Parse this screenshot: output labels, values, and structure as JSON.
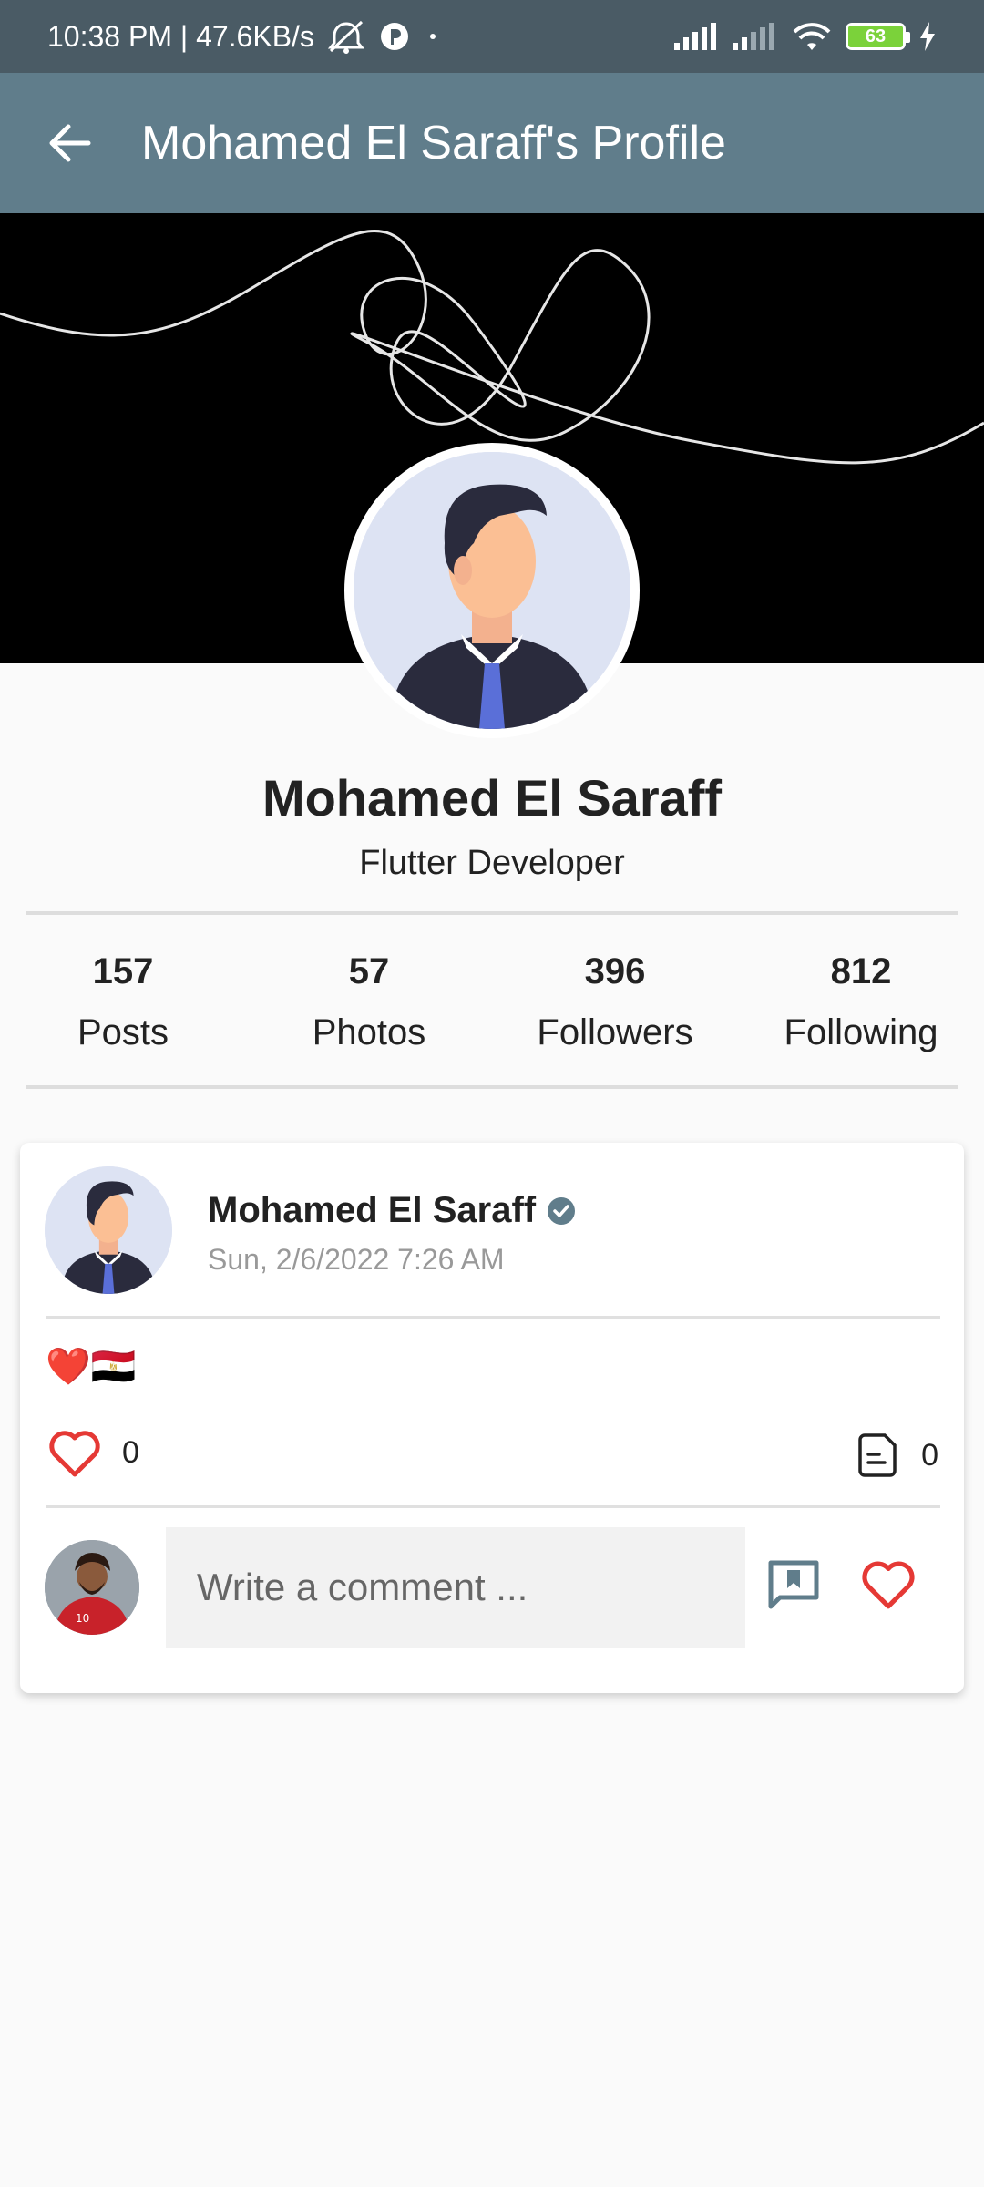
{
  "status_bar": {
    "left_text": "10:38 PM | 47.6KB/s",
    "battery_level": "63"
  },
  "app_bar": {
    "title": "Mohamed El Saraff's Profile"
  },
  "profile": {
    "name": "Mohamed El Saraff",
    "role": "Flutter Developer"
  },
  "stats": [
    {
      "value": "157",
      "label": "Posts"
    },
    {
      "value": "57",
      "label": "Photos"
    },
    {
      "value": "396",
      "label": "Followers"
    },
    {
      "value": "812",
      "label": "Following"
    }
  ],
  "post": {
    "author": "Mohamed El Saraff",
    "date": "Sun, 2/6/2022 7:26 AM",
    "content": "❤️🇪🇬",
    "likes": "0",
    "comments": "0",
    "comment_placeholder": "Write a comment ..."
  },
  "colors": {
    "status_bar": "#4a5b65",
    "app_bar": "#607d8b",
    "like_red": "#e53935",
    "verified": "#607d8b"
  }
}
